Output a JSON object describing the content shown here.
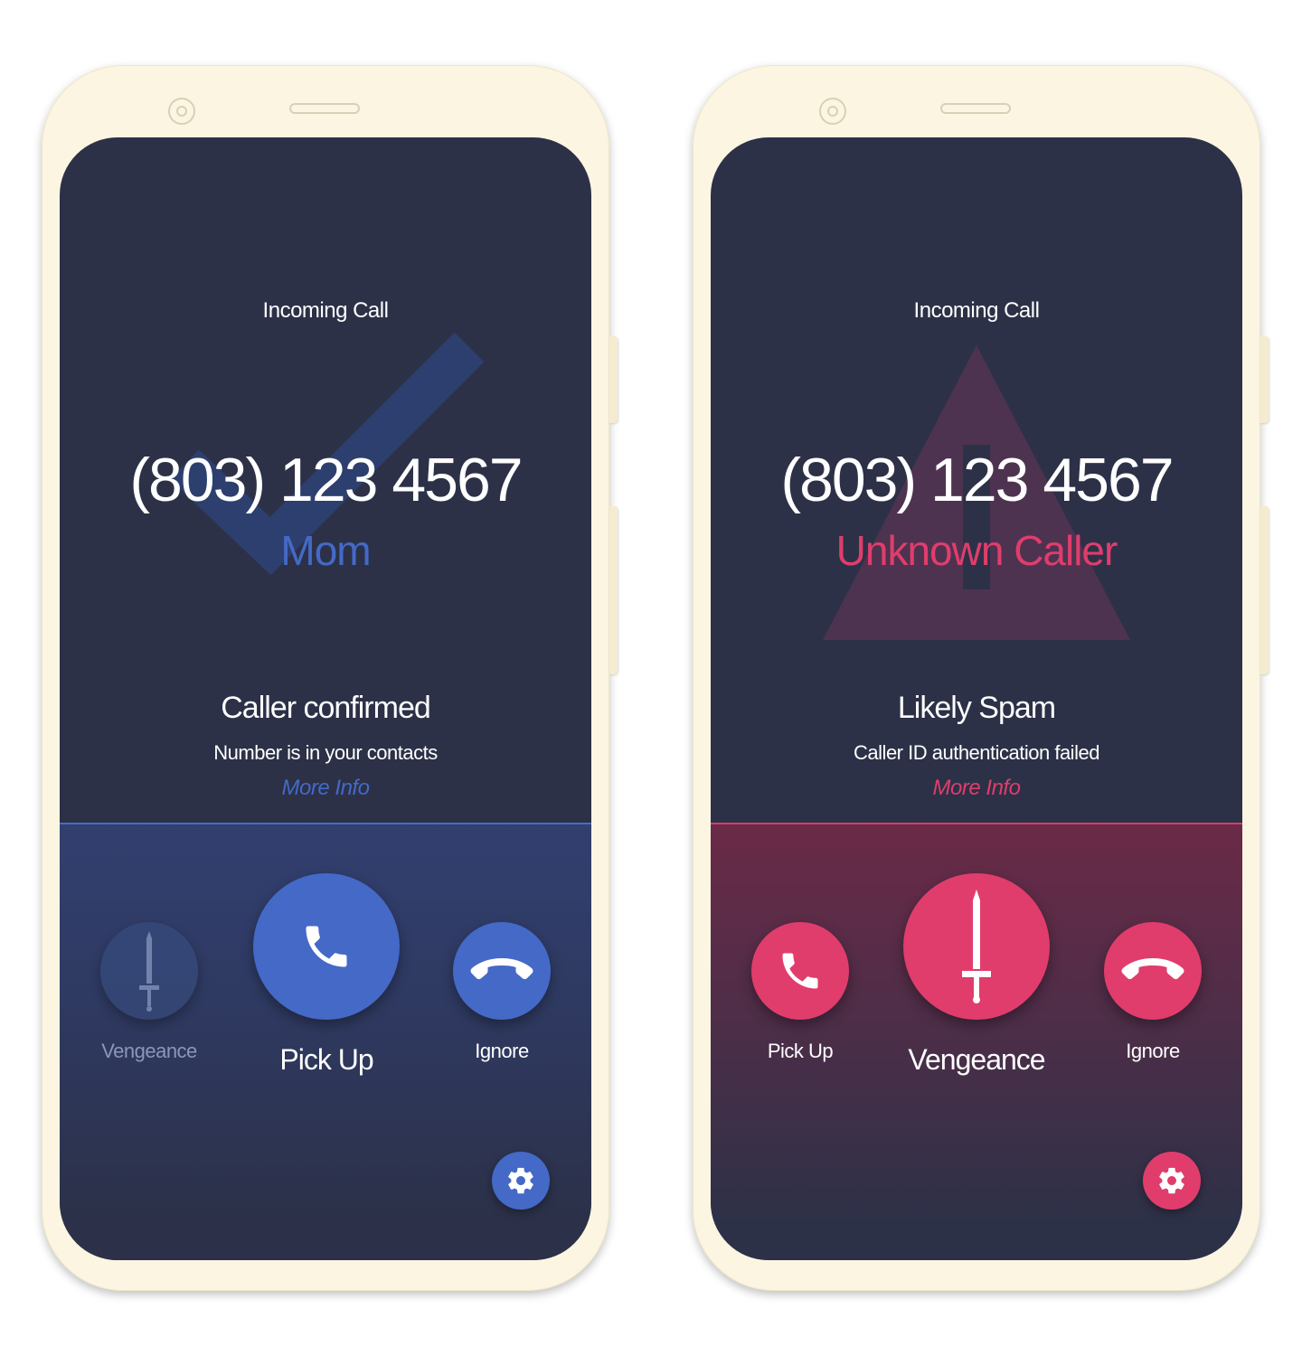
{
  "colors": {
    "blue_accent": "#4469c7",
    "pink_accent": "#e03d6c",
    "screen_bg": "#2c3147",
    "phone_body": "#fbf5e2"
  },
  "phones": [
    {
      "header": "Incoming Call",
      "number": "(803) 123 4567",
      "caller_name": "Mom",
      "status_title": "Caller confirmed",
      "status_subtitle": "Number is in your contacts",
      "more_info": "More Info",
      "background_icon": "check-icon",
      "actions": {
        "left": {
          "label": "Vengeance",
          "icon": "sword-icon"
        },
        "center": {
          "label": "Pick Up",
          "icon": "phone-icon"
        },
        "right": {
          "label": "Ignore",
          "icon": "hang-up-icon"
        }
      },
      "settings_icon": "gear-icon"
    },
    {
      "header": "Incoming Call",
      "number": "(803) 123 4567",
      "caller_name": "Unknown Caller",
      "status_title": "Likely Spam",
      "status_subtitle": "Caller ID authentication failed",
      "more_info": "More Info",
      "background_icon": "warning-icon",
      "actions": {
        "left": {
          "label": "Pick Up",
          "icon": "phone-icon"
        },
        "center": {
          "label": "Vengeance",
          "icon": "sword-icon"
        },
        "right": {
          "label": "Ignore",
          "icon": "hang-up-icon"
        }
      },
      "settings_icon": "gear-icon"
    }
  ]
}
